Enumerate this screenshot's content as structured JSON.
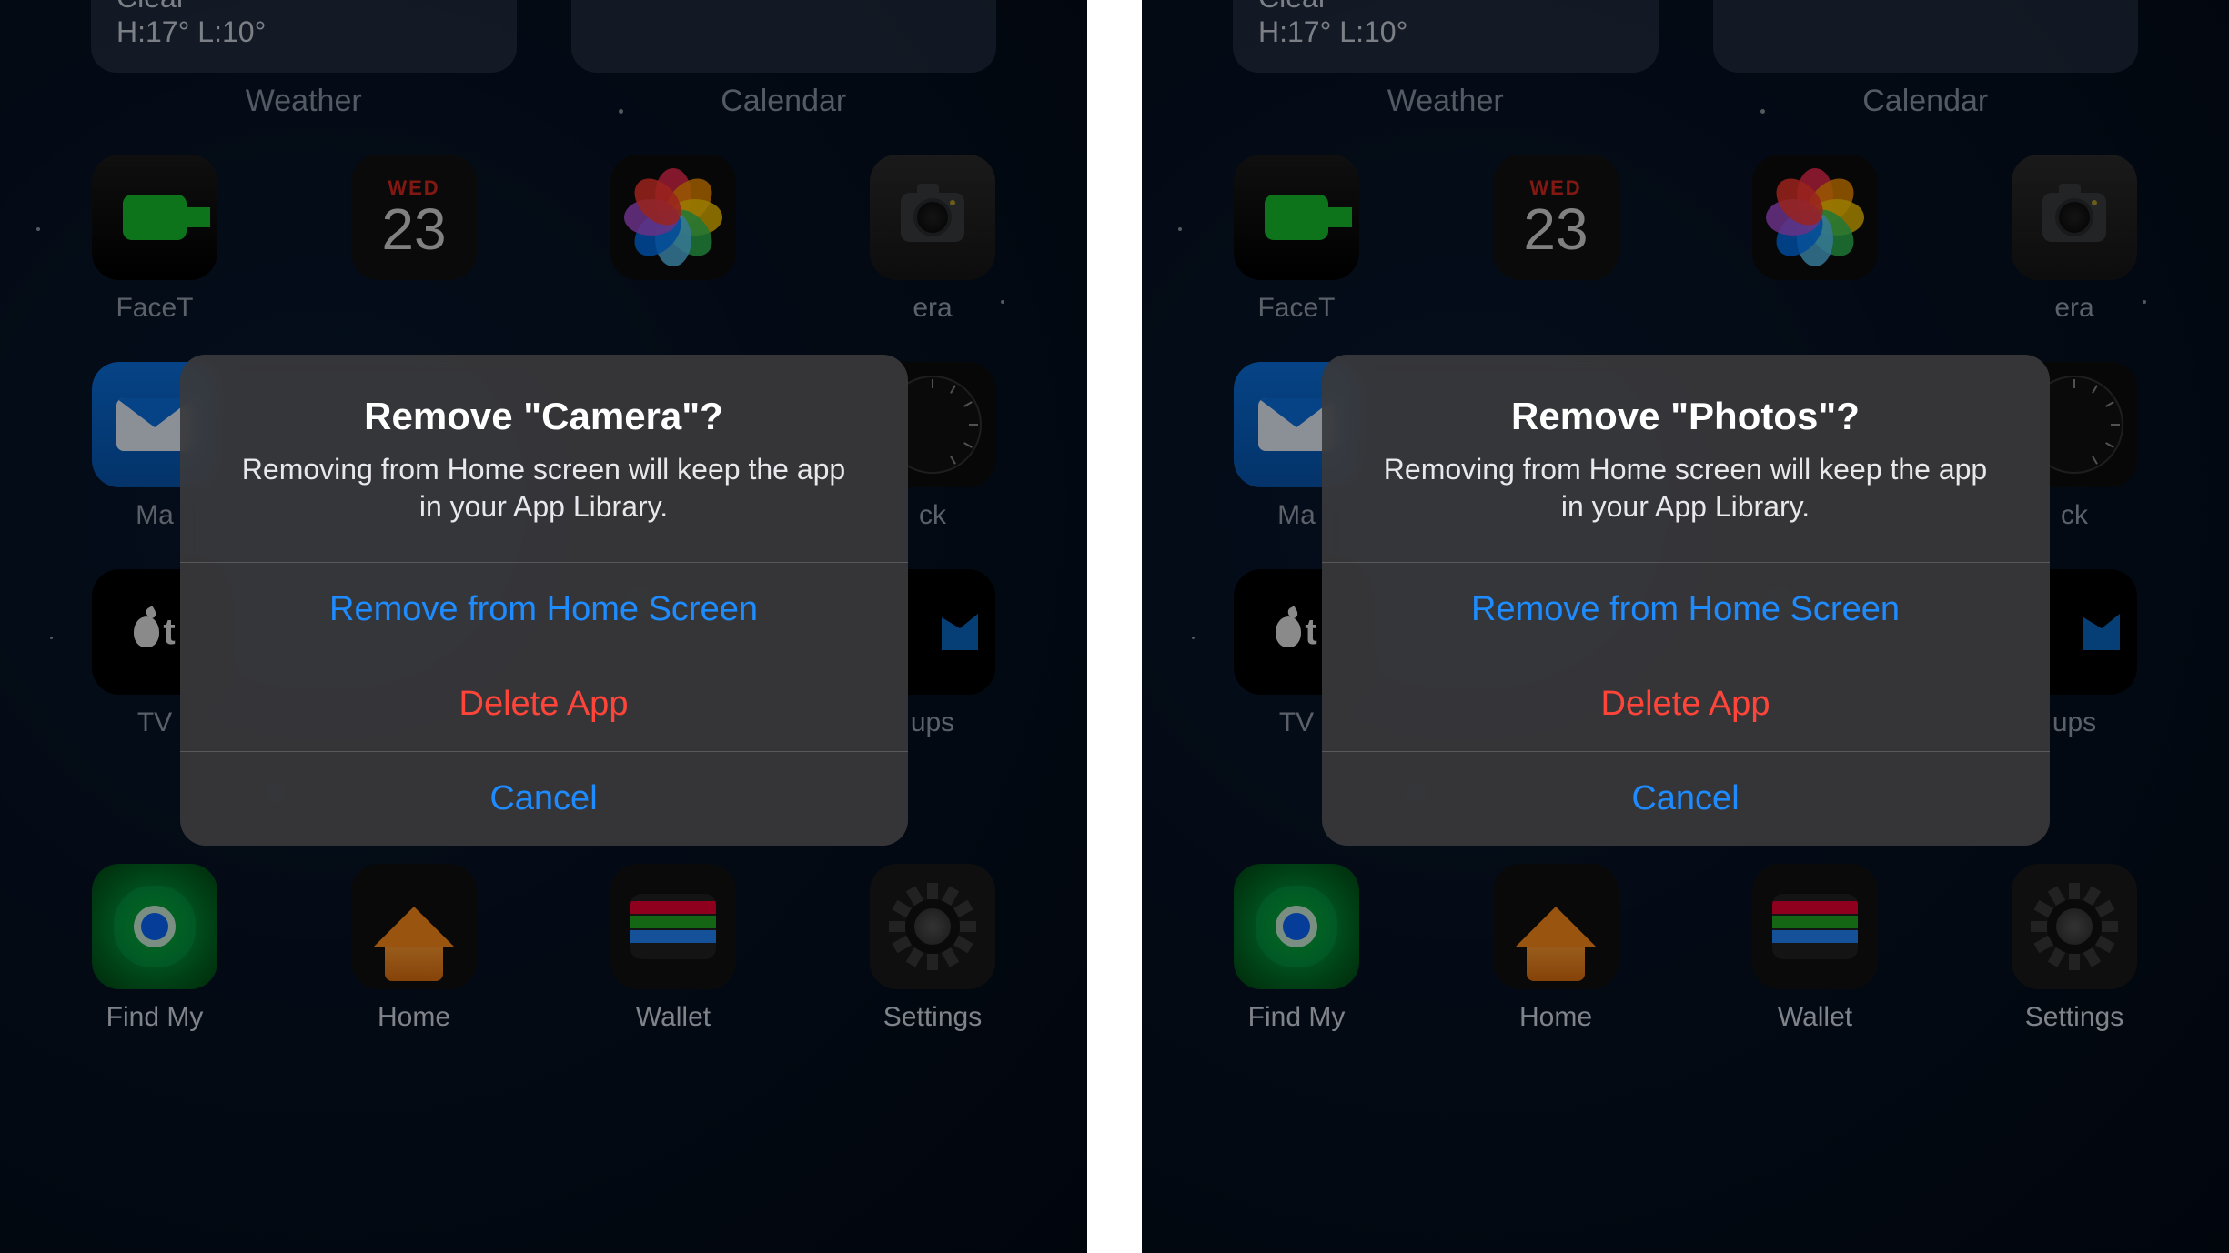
{
  "weather": {
    "condition": "Clear",
    "hilo": "H:17° L:10°"
  },
  "widget_labels": {
    "weather": "Weather",
    "calendar": "Calendar"
  },
  "calendar_icon": {
    "day_abbr": "WED",
    "day_num": "23"
  },
  "apps": {
    "facetime": "FaceTime",
    "camera": "Camera",
    "mail": "Mail",
    "clock": "Clock",
    "tv": "TV",
    "stocks_suffix": "ups",
    "findmy": "Find My",
    "home": "Home",
    "wallet": "Wallet",
    "settings": "Settings"
  },
  "partial": {
    "facetime": "FaceT",
    "camera": "era",
    "mail": "Ma",
    "clock": "ck",
    "tv": "TV"
  },
  "alerts": [
    {
      "title": "Remove \"Camera\"?",
      "message": "Removing from Home screen will keep the app in your App Library.",
      "remove": "Remove from Home Screen",
      "delete": "Delete App",
      "cancel": "Cancel"
    },
    {
      "title": "Remove \"Photos\"?",
      "message": "Removing from Home screen will keep the app in your App Library.",
      "remove": "Remove from Home Screen",
      "delete": "Delete App",
      "cancel": "Cancel"
    }
  ]
}
